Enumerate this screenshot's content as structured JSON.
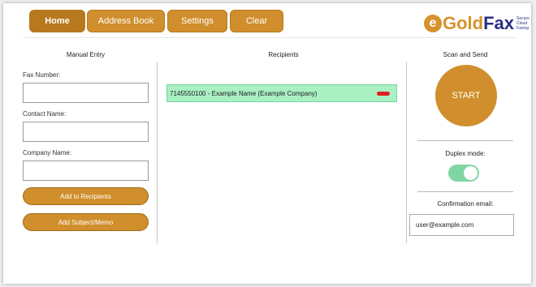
{
  "tabs": [
    {
      "label": "Home"
    },
    {
      "label": "Address Book"
    },
    {
      "label": "Settings"
    },
    {
      "label": "Clear"
    }
  ],
  "logo": {
    "e": "e",
    "gold": "Gold",
    "fax": "Fax",
    "tagline": [
      "Secure",
      "Cloud",
      "Faxing"
    ]
  },
  "manual_entry": {
    "title": "Manual Entry",
    "fax_label": "Fax Number:",
    "fax_value": "",
    "contact_label": "Contact Name:",
    "contact_value": "",
    "company_label": "Company Name:",
    "company_value": "",
    "add_button": "Add to Recipients",
    "memo_button": "Add Subject/Memo"
  },
  "recipients": {
    "title": "Recipients",
    "items": [
      {
        "text": "7145550100 - Example Name (Example Company)"
      }
    ]
  },
  "scan_send": {
    "title": "Scan and Send",
    "start_label": "START",
    "duplex_label": "Duplex mode:",
    "duplex_on": true,
    "confirm_label": "Confirmation email:",
    "email_value": "user@example.com"
  },
  "colors": {
    "accent": "#d08f2c",
    "recipient_bg": "#a9f0c3",
    "toggle_on": "#7fd6a3",
    "remove": "#e01f1f",
    "brand_blue": "#2b2e83"
  }
}
